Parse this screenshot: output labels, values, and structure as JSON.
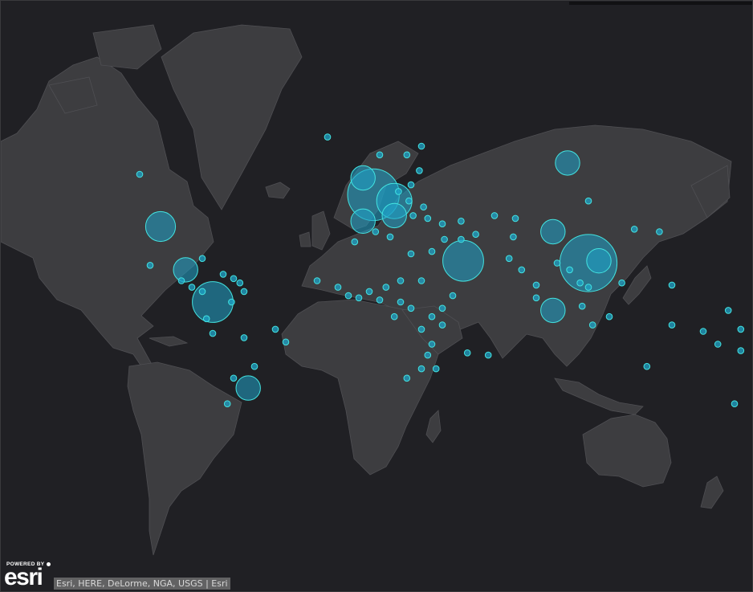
{
  "map": {
    "basemap": "dark-gray-canvas",
    "colors": {
      "ocean": "#202024",
      "land": "#3d3d40",
      "border": "#4f4f53",
      "marker_fill": "#1fa3c8",
      "marker_stroke": "#43e3e0"
    },
    "points": [
      {
        "lon": -100,
        "lat": 38,
        "magnitude": 4
      },
      {
        "lon": -88,
        "lat": 20,
        "magnitude": 3
      },
      {
        "lon": -75,
        "lat": 5,
        "magnitude": 6
      },
      {
        "lon": -58,
        "lat": -34,
        "magnitude": 3
      },
      {
        "lon": -3,
        "lat": 40,
        "magnitude": 3
      },
      {
        "lon": -3,
        "lat": 54,
        "magnitude": 3
      },
      {
        "lon": 2,
        "lat": 49,
        "magnitude": 8
      },
      {
        "lon": 12,
        "lat": 47,
        "magnitude": 5
      },
      {
        "lon": 12,
        "lat": 42,
        "magnitude": 3
      },
      {
        "lon": 45,
        "lat": 24,
        "magnitude": 6
      },
      {
        "lon": 95,
        "lat": 58,
        "magnitude": 3
      },
      {
        "lon": 88,
        "lat": 36,
        "magnitude": 3
      },
      {
        "lon": 105,
        "lat": 23,
        "magnitude": 9
      },
      {
        "lon": 110,
        "lat": 24,
        "magnitude": 3
      },
      {
        "lon": 88,
        "lat": 1,
        "magnitude": 3
      },
      {
        "lon": -110,
        "lat": 55,
        "magnitude": 1
      },
      {
        "lon": -105,
        "lat": 22,
        "magnitude": 1
      },
      {
        "lon": -80,
        "lat": 25,
        "magnitude": 1
      },
      {
        "lon": -90,
        "lat": 15,
        "magnitude": 1
      },
      {
        "lon": -85,
        "lat": 12,
        "magnitude": 1
      },
      {
        "lon": -80,
        "lat": 10,
        "magnitude": 1
      },
      {
        "lon": -70,
        "lat": 18,
        "magnitude": 1
      },
      {
        "lon": -65,
        "lat": 16,
        "magnitude": 1
      },
      {
        "lon": -62,
        "lat": 14,
        "magnitude": 1
      },
      {
        "lon": -60,
        "lat": 10,
        "magnitude": 1
      },
      {
        "lon": -66,
        "lat": 5,
        "magnitude": 1
      },
      {
        "lon": -78,
        "lat": -3,
        "magnitude": 1
      },
      {
        "lon": -75,
        "lat": -10,
        "magnitude": 1
      },
      {
        "lon": -60,
        "lat": -12,
        "magnitude": 1
      },
      {
        "lon": -45,
        "lat": -8,
        "magnitude": 1
      },
      {
        "lon": -40,
        "lat": -14,
        "magnitude": 1
      },
      {
        "lon": -55,
        "lat": -25,
        "magnitude": 1
      },
      {
        "lon": -65,
        "lat": -30,
        "magnitude": 1
      },
      {
        "lon": -68,
        "lat": -40,
        "magnitude": 1
      },
      {
        "lon": -20,
        "lat": 64,
        "magnitude": 1
      },
      {
        "lon": -25,
        "lat": 15,
        "magnitude": 1
      },
      {
        "lon": -15,
        "lat": 12,
        "magnitude": 1
      },
      {
        "lon": -10,
        "lat": 8,
        "magnitude": 1
      },
      {
        "lon": -5,
        "lat": 7,
        "magnitude": 1
      },
      {
        "lon": 0,
        "lat": 10,
        "magnitude": 1
      },
      {
        "lon": 5,
        "lat": 6,
        "magnitude": 1
      },
      {
        "lon": 8,
        "lat": 12,
        "magnitude": 1
      },
      {
        "lon": 15,
        "lat": 5,
        "magnitude": 1
      },
      {
        "lon": 12,
        "lat": -2,
        "magnitude": 1
      },
      {
        "lon": 20,
        "lat": 2,
        "magnitude": 1
      },
      {
        "lon": 25,
        "lat": -8,
        "magnitude": 1
      },
      {
        "lon": 30,
        "lat": -2,
        "magnitude": 1
      },
      {
        "lon": 35,
        "lat": 2,
        "magnitude": 1
      },
      {
        "lon": 40,
        "lat": 8,
        "magnitude": 1
      },
      {
        "lon": 35,
        "lat": -6,
        "magnitude": 1
      },
      {
        "lon": 30,
        "lat": -15,
        "magnitude": 1
      },
      {
        "lon": 28,
        "lat": -20,
        "magnitude": 1
      },
      {
        "lon": 25,
        "lat": -26,
        "magnitude": 1
      },
      {
        "lon": 18,
        "lat": -30,
        "magnitude": 1
      },
      {
        "lon": 32,
        "lat": -26,
        "magnitude": 1
      },
      {
        "lon": 47,
        "lat": -19,
        "magnitude": 1
      },
      {
        "lon": 57,
        "lat": -20,
        "magnitude": 1
      },
      {
        "lon": 30,
        "lat": 28,
        "magnitude": 1
      },
      {
        "lon": 10,
        "lat": 34,
        "magnitude": 1
      },
      {
        "lon": 3,
        "lat": 36,
        "magnitude": 1
      },
      {
        "lon": -7,
        "lat": 32,
        "magnitude": 1
      },
      {
        "lon": 20,
        "lat": 27,
        "magnitude": 1
      },
      {
        "lon": 15,
        "lat": 15,
        "magnitude": 1
      },
      {
        "lon": 25,
        "lat": 15,
        "magnitude": 1
      },
      {
        "lon": 5,
        "lat": 60,
        "magnitude": 1
      },
      {
        "lon": 18,
        "lat": 60,
        "magnitude": 1
      },
      {
        "lon": 25,
        "lat": 62,
        "magnitude": 1
      },
      {
        "lon": 24,
        "lat": 56,
        "magnitude": 1
      },
      {
        "lon": 20,
        "lat": 52,
        "magnitude": 1
      },
      {
        "lon": 14,
        "lat": 50,
        "magnitude": 1
      },
      {
        "lon": 19,
        "lat": 47,
        "magnitude": 1
      },
      {
        "lon": 26,
        "lat": 45,
        "magnitude": 1
      },
      {
        "lon": 21,
        "lat": 42,
        "magnitude": 1
      },
      {
        "lon": 28,
        "lat": 41,
        "magnitude": 1
      },
      {
        "lon": 35,
        "lat": 39,
        "magnitude": 1
      },
      {
        "lon": 44,
        "lat": 40,
        "magnitude": 1
      },
      {
        "lon": 36,
        "lat": 33,
        "magnitude": 1
      },
      {
        "lon": 44,
        "lat": 33,
        "magnitude": 1
      },
      {
        "lon": 51,
        "lat": 35,
        "magnitude": 1
      },
      {
        "lon": 60,
        "lat": 42,
        "magnitude": 1
      },
      {
        "lon": 70,
        "lat": 41,
        "magnitude": 1
      },
      {
        "lon": 69,
        "lat": 34,
        "magnitude": 1
      },
      {
        "lon": 67,
        "lat": 25,
        "magnitude": 1
      },
      {
        "lon": 73,
        "lat": 20,
        "magnitude": 1
      },
      {
        "lon": 80,
        "lat": 13,
        "magnitude": 1
      },
      {
        "lon": 80,
        "lat": 7,
        "magnitude": 1
      },
      {
        "lon": 90,
        "lat": 23,
        "magnitude": 1
      },
      {
        "lon": 96,
        "lat": 20,
        "magnitude": 1
      },
      {
        "lon": 101,
        "lat": 14,
        "magnitude": 1
      },
      {
        "lon": 105,
        "lat": 12,
        "magnitude": 1
      },
      {
        "lon": 102,
        "lat": 3,
        "magnitude": 1
      },
      {
        "lon": 107,
        "lat": -6,
        "magnitude": 1
      },
      {
        "lon": 115,
        "lat": -2,
        "magnitude": 1
      },
      {
        "lon": 121,
        "lat": 14,
        "magnitude": 1
      },
      {
        "lon": 127,
        "lat": 37,
        "magnitude": 1
      },
      {
        "lon": 139,
        "lat": 36,
        "magnitude": 1
      },
      {
        "lon": 105,
        "lat": 47,
        "magnitude": 1
      },
      {
        "lon": 145,
        "lat": 13,
        "magnitude": 1
      },
      {
        "lon": 145,
        "lat": -6,
        "magnitude": 1
      },
      {
        "lon": 133,
        "lat": -25,
        "magnitude": 1
      },
      {
        "lon": 175,
        "lat": -40,
        "magnitude": 1
      },
      {
        "lon": 160,
        "lat": -9,
        "magnitude": 1
      },
      {
        "lon": 167,
        "lat": -15,
        "magnitude": 1
      },
      {
        "lon": 178,
        "lat": -18,
        "magnitude": 1
      },
      {
        "lon": 172,
        "lat": 1,
        "magnitude": 1
      },
      {
        "lon": 178,
        "lat": -8,
        "magnitude": 1
      }
    ]
  },
  "logo": {
    "powered_by": "POWERED BY",
    "brand": "esri"
  },
  "attribution": {
    "text": "Esri, HERE, DeLorme, NGA, USGS | Esri"
  }
}
